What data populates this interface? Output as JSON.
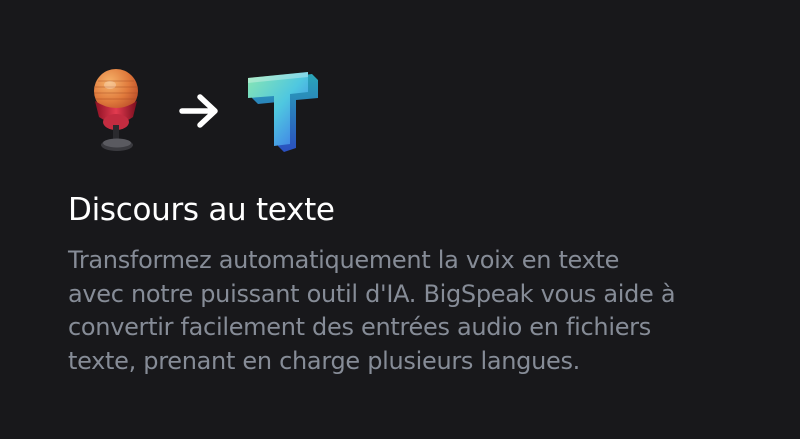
{
  "feature": {
    "icons": [
      "microphone-icon",
      "arrow-right-icon",
      "text-t-icon"
    ],
    "title": "Discours au texte",
    "description_lines": [
      "Transformez automatiquement la voix en texte",
      "avec notre puissant outil d'IA. BigSpeak vous aide à",
      "convertir facilement des entrées audio en fichiers",
      "texte, prenant en charge plusieurs langues."
    ]
  },
  "colors": {
    "background": "#18181b",
    "title": "#ffffff",
    "description": "#868c97"
  }
}
